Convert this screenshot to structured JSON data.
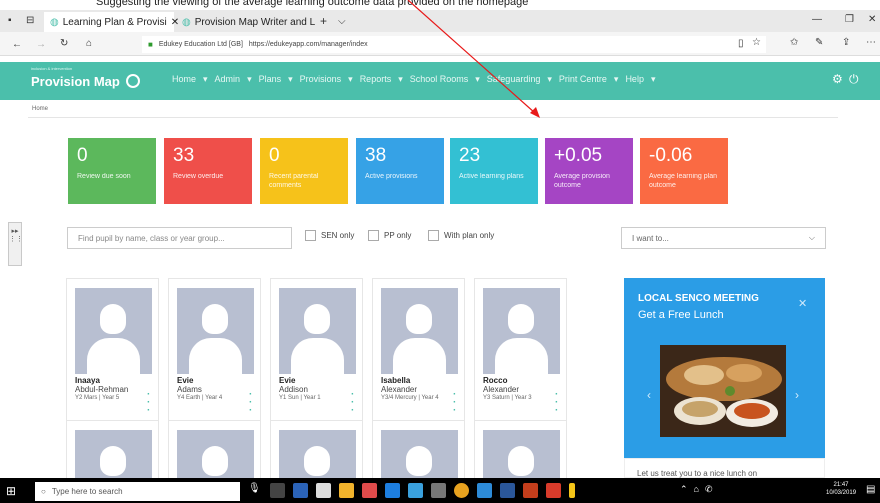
{
  "instruction": "Suggesting the viewing of the average learning outcome data provided on the homepage",
  "browser": {
    "tabs": [
      {
        "label": "Learning Plan & Provisi"
      },
      {
        "label": "Provision Map Writer and L"
      }
    ],
    "new_tab": "+",
    "url_site": "Edukey Education Ltd [GB]",
    "url": "https://edukeyapp.com/manager/index"
  },
  "app": {
    "logo_text": "Provision Map",
    "logo_sub": "inclusion & intervention",
    "nav": [
      "Home",
      "Admin",
      "Plans",
      "Provisions",
      "Reports",
      "School Rooms",
      "Safeguarding",
      "Print Centre",
      "Help"
    ],
    "breadcrumb": "Home"
  },
  "tiles": [
    {
      "value": "0",
      "label": "Review due soon",
      "color": "#5cb85c"
    },
    {
      "value": "33",
      "label": "Review overdue",
      "color": "#ef4f4a"
    },
    {
      "value": "0",
      "label": "Recent parental comments",
      "color": "#f6c21a"
    },
    {
      "value": "38",
      "label": "Active provisions",
      "color": "#36a2e6"
    },
    {
      "value": "23",
      "label": "Active learning plans",
      "color": "#33c0d3"
    },
    {
      "value": "+0.05",
      "label": "Average provision outcome",
      "color": "#a545c4"
    },
    {
      "value": "-0.06",
      "label": "Average learning plan outcome",
      "color": "#fa6a43"
    }
  ],
  "filters": {
    "search_placeholder": "Find pupil by name, class or year group...",
    "sen_only": "SEN only",
    "pp_only": "PP only",
    "with_plan_only": "With plan only",
    "i_want_to": "I want to..."
  },
  "pupils": [
    {
      "first": "Inaaya",
      "last": "Abdul-Rehman",
      "class": "Y2 Mars | Year 5"
    },
    {
      "first": "Evie",
      "last": "Adams",
      "class": "Y4 Earth | Year 4"
    },
    {
      "first": "Evie",
      "last": "Addison",
      "class": "Y1 Sun | Year 1"
    },
    {
      "first": "Isabella",
      "last": "Alexander",
      "class": "Y3/4 Mercury | Year 4"
    },
    {
      "first": "Rocco",
      "last": "Alexander",
      "class": "Y3 Saturn | Year 3"
    }
  ],
  "promo": {
    "title": "LOCAL SENCO MEETING",
    "subtitle": "Get a Free Lunch",
    "text": "Let us treat you to a nice lunch on"
  },
  "taskbar": {
    "search": "Type here to search",
    "time": "21:47",
    "date": "10/03/2019"
  }
}
